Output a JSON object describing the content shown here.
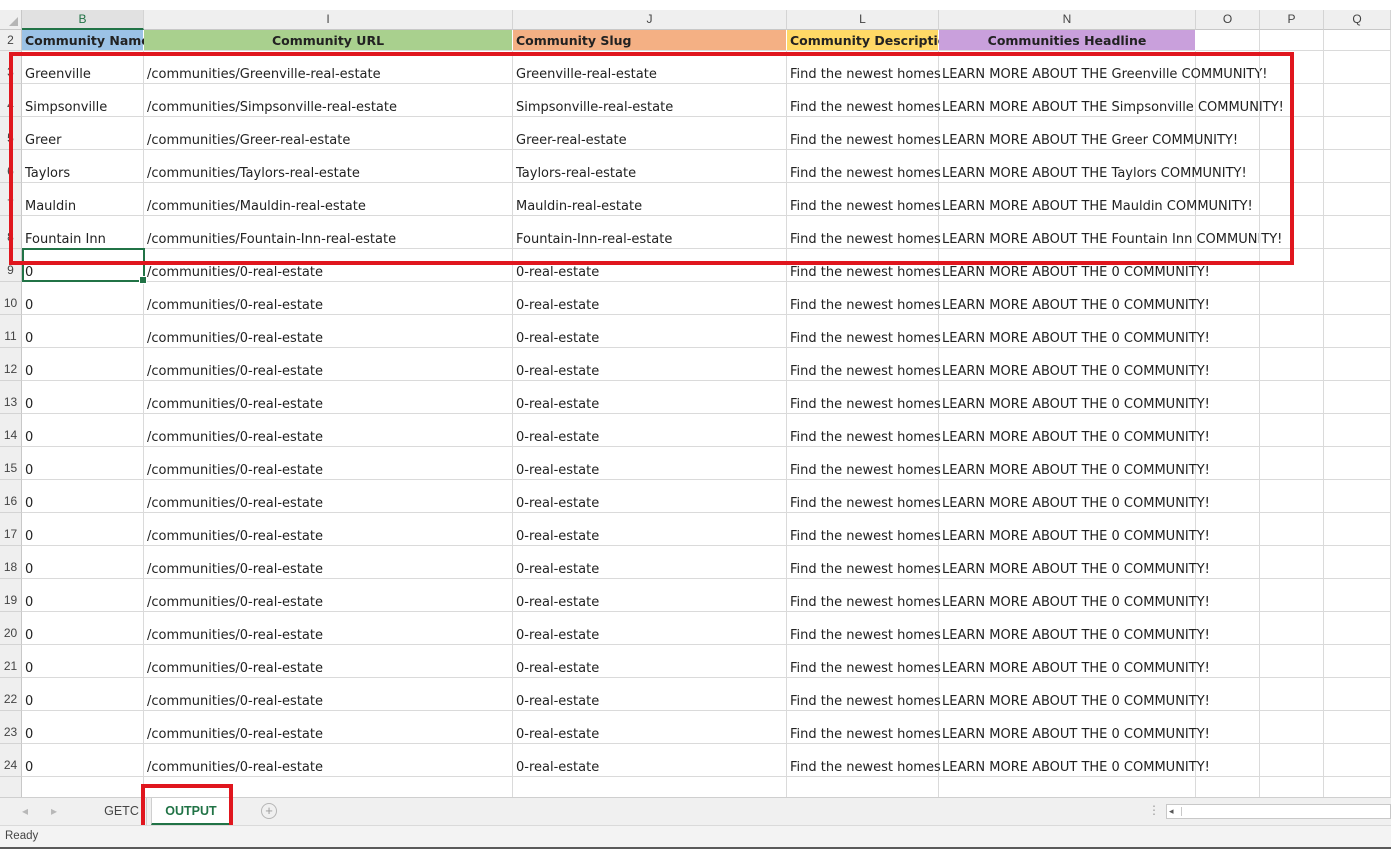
{
  "columns": [
    {
      "letter": "B",
      "selected": true
    },
    {
      "letter": "I",
      "selected": false
    },
    {
      "letter": "J",
      "selected": false
    },
    {
      "letter": "L",
      "selected": false
    },
    {
      "letter": "N",
      "selected": false
    },
    {
      "letter": "O",
      "selected": false
    },
    {
      "letter": "P",
      "selected": false
    },
    {
      "letter": "Q",
      "selected": false
    }
  ],
  "header_row": {
    "row_number": "2",
    "cells": [
      {
        "text": "Community Name",
        "color": "#9bc2e6"
      },
      {
        "text": "Community URL",
        "color": "#a9d08e"
      },
      {
        "text": "Community Slug",
        "color": "#f4b084"
      },
      {
        "text": "Community Description",
        "color": "#ffd966"
      },
      {
        "text": "Communities Headline",
        "color": "#c9a0dc"
      }
    ]
  },
  "rows": [
    {
      "num": "3",
      "cells": [
        "Greenville",
        "/communities/Greenville-real-estate",
        "Greenville-real-estate",
        "Find the newest homes",
        "LEARN MORE ABOUT THE Greenville COMMUNITY!"
      ]
    },
    {
      "num": "4",
      "cells": [
        "Simpsonville",
        "/communities/Simpsonville-real-estate",
        "Simpsonville-real-estate",
        "Find the newest homes",
        "LEARN MORE ABOUT THE Simpsonville COMMUNITY!"
      ]
    },
    {
      "num": "5",
      "cells": [
        "Greer",
        "/communities/Greer-real-estate",
        "Greer-real-estate",
        "Find the newest homes",
        "LEARN MORE ABOUT THE Greer COMMUNITY!"
      ]
    },
    {
      "num": "6",
      "cells": [
        "Taylors",
        "/communities/Taylors-real-estate",
        "Taylors-real-estate",
        "Find the newest homes",
        "LEARN MORE ABOUT THE Taylors COMMUNITY!"
      ]
    },
    {
      "num": "7",
      "cells": [
        "Mauldin",
        "/communities/Mauldin-real-estate",
        "Mauldin-real-estate",
        "Find the newest homes",
        "LEARN MORE ABOUT THE Mauldin COMMUNITY!"
      ]
    },
    {
      "num": "8",
      "cells": [
        "Fountain Inn",
        "/communities/Fountain-Inn-real-estate",
        "Fountain-Inn-real-estate",
        "Find the newest homes",
        "LEARN MORE ABOUT THE Fountain Inn COMMUNITY!"
      ]
    },
    {
      "num": "9",
      "cells": [
        "0",
        "/communities/0-real-estate",
        "0-real-estate",
        "Find the newest homes",
        "LEARN MORE ABOUT THE 0 COMMUNITY!"
      ]
    },
    {
      "num": "10",
      "cells": [
        "0",
        "/communities/0-real-estate",
        "0-real-estate",
        "Find the newest homes",
        "LEARN MORE ABOUT THE 0 COMMUNITY!"
      ]
    },
    {
      "num": "11",
      "cells": [
        "0",
        "/communities/0-real-estate",
        "0-real-estate",
        "Find the newest homes",
        "LEARN MORE ABOUT THE 0 COMMUNITY!"
      ]
    },
    {
      "num": "12",
      "cells": [
        "0",
        "/communities/0-real-estate",
        "0-real-estate",
        "Find the newest homes",
        "LEARN MORE ABOUT THE 0 COMMUNITY!"
      ]
    },
    {
      "num": "13",
      "cells": [
        "0",
        "/communities/0-real-estate",
        "0-real-estate",
        "Find the newest homes",
        "LEARN MORE ABOUT THE 0 COMMUNITY!"
      ]
    },
    {
      "num": "14",
      "cells": [
        "0",
        "/communities/0-real-estate",
        "0-real-estate",
        "Find the newest homes",
        "LEARN MORE ABOUT THE 0 COMMUNITY!"
      ]
    },
    {
      "num": "15",
      "cells": [
        "0",
        "/communities/0-real-estate",
        "0-real-estate",
        "Find the newest homes",
        "LEARN MORE ABOUT THE 0 COMMUNITY!"
      ]
    },
    {
      "num": "16",
      "cells": [
        "0",
        "/communities/0-real-estate",
        "0-real-estate",
        "Find the newest homes",
        "LEARN MORE ABOUT THE 0 COMMUNITY!"
      ]
    },
    {
      "num": "17",
      "cells": [
        "0",
        "/communities/0-real-estate",
        "0-real-estate",
        "Find the newest homes",
        "LEARN MORE ABOUT THE 0 COMMUNITY!"
      ]
    },
    {
      "num": "18",
      "cells": [
        "0",
        "/communities/0-real-estate",
        "0-real-estate",
        "Find the newest homes",
        "LEARN MORE ABOUT THE 0 COMMUNITY!"
      ]
    },
    {
      "num": "19",
      "cells": [
        "0",
        "/communities/0-real-estate",
        "0-real-estate",
        "Find the newest homes",
        "LEARN MORE ABOUT THE 0 COMMUNITY!"
      ]
    },
    {
      "num": "20",
      "cells": [
        "0",
        "/communities/0-real-estate",
        "0-real-estate",
        "Find the newest homes",
        "LEARN MORE ABOUT THE 0 COMMUNITY!"
      ]
    },
    {
      "num": "21",
      "cells": [
        "0",
        "/communities/0-real-estate",
        "0-real-estate",
        "Find the newest homes",
        "LEARN MORE ABOUT THE 0 COMMUNITY!"
      ]
    },
    {
      "num": "22",
      "cells": [
        "0",
        "/communities/0-real-estate",
        "0-real-estate",
        "Find the newest homes",
        "LEARN MORE ABOUT THE 0 COMMUNITY!"
      ]
    },
    {
      "num": "23",
      "cells": [
        "0",
        "/communities/0-real-estate",
        "0-real-estate",
        "Find the newest homes",
        "LEARN MORE ABOUT THE 0 COMMUNITY!"
      ]
    },
    {
      "num": "24",
      "cells": [
        "0",
        "/communities/0-real-estate",
        "0-real-estate",
        "Find the newest homes",
        "LEARN MORE ABOUT THE 0 COMMUNITY!"
      ]
    }
  ],
  "tabs": [
    {
      "label": "GETC",
      "active": false
    },
    {
      "label": "OUTPUT",
      "active": true
    }
  ],
  "icons": {
    "prev_sheet": "◂",
    "next_sheet": "▸",
    "add_sheet": "+",
    "options_dots": "⋮",
    "scroll_left": "◂"
  },
  "status": {
    "text": "Ready"
  },
  "colors": {
    "accent": "#217346",
    "highlight_box": "#e0161e"
  }
}
